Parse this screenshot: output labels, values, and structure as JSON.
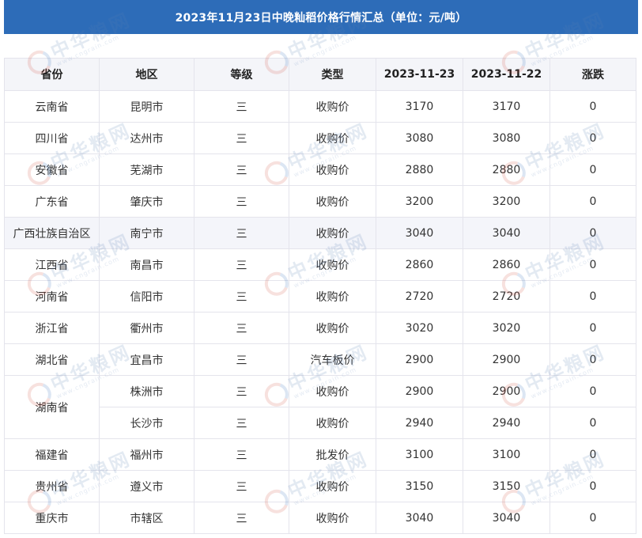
{
  "title": "2023年11月23日中晚籼稻价格行情汇总（单位：元/吨）",
  "watermark": {
    "cn": "中华粮网",
    "url": "www.cngrain.com",
    "logo": "cngrain-logo-icon"
  },
  "columns": [
    "省份",
    "地区",
    "等级",
    "类型",
    "2023-11-23",
    "2023-11-22",
    "涨跌"
  ],
  "rows": [
    {
      "province": "云南省",
      "city": "昆明市",
      "grade": "三",
      "type": "收购价",
      "p1": "3170",
      "p2": "3170",
      "chg": "0"
    },
    {
      "province": "四川省",
      "city": "达州市",
      "grade": "三",
      "type": "收购价",
      "p1": "3080",
      "p2": "3080",
      "chg": "0"
    },
    {
      "province": "安徽省",
      "city": "芜湖市",
      "grade": "三",
      "type": "收购价",
      "p1": "2880",
      "p2": "2880",
      "chg": "0"
    },
    {
      "province": "广东省",
      "city": "肇庆市",
      "grade": "三",
      "type": "收购价",
      "p1": "3200",
      "p2": "3200",
      "chg": "0"
    },
    {
      "province": "广西壮族自治区",
      "city": "南宁市",
      "grade": "三",
      "type": "收购价",
      "p1": "3040",
      "p2": "3040",
      "chg": "0"
    },
    {
      "province": "江西省",
      "city": "南昌市",
      "grade": "三",
      "type": "收购价",
      "p1": "2860",
      "p2": "2860",
      "chg": "0"
    },
    {
      "province": "河南省",
      "city": "信阳市",
      "grade": "三",
      "type": "收购价",
      "p1": "2720",
      "p2": "2720",
      "chg": "0"
    },
    {
      "province": "浙江省",
      "city": "衢州市",
      "grade": "三",
      "type": "收购价",
      "p1": "3020",
      "p2": "3020",
      "chg": "0"
    },
    {
      "province": "湖北省",
      "city": "宜昌市",
      "grade": "三",
      "type": "汽车板价",
      "p1": "2900",
      "p2": "2900",
      "chg": "0"
    },
    {
      "province": "湖南省",
      "city": "株洲市",
      "grade": "三",
      "type": "收购价",
      "p1": "2900",
      "p2": "2900",
      "chg": "0"
    },
    {
      "province": "",
      "city": "长沙市",
      "grade": "三",
      "type": "收购价",
      "p1": "2940",
      "p2": "2940",
      "chg": "0"
    },
    {
      "province": "福建省",
      "city": "福州市",
      "grade": "三",
      "type": "批发价",
      "p1": "3100",
      "p2": "3100",
      "chg": "0"
    },
    {
      "province": "贵州省",
      "city": "遵义市",
      "grade": "三",
      "type": "收购价",
      "p1": "3150",
      "p2": "3150",
      "chg": "0"
    },
    {
      "province": "重庆市",
      "city": "市辖区",
      "grade": "三",
      "type": "收购价",
      "p1": "3040",
      "p2": "3040",
      "chg": "0"
    }
  ]
}
